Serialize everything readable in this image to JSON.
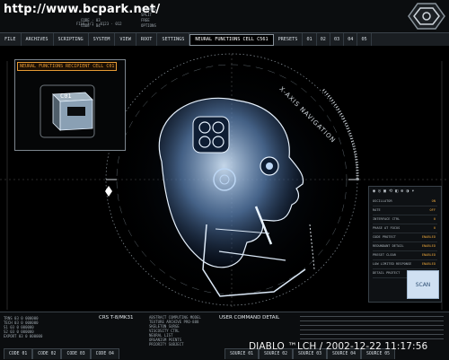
{
  "header": {
    "url": "http://www.bcpark.net/",
    "info_blocks": [
      [
        "FILE 1/1 · 0123 · 012"
      ],
      [
        "CODE · 03",
        "CODE · 04 ·"
      ],
      [
        "4 COMPS",
        "SPLIT",
        "FREE",
        "OPTIONS"
      ]
    ]
  },
  "menu": {
    "items": [
      "FILE",
      "ARCHIVES",
      "SCRIPTING",
      "SYSTEM",
      "VIEW",
      "ROOT",
      "SETTINGS"
    ],
    "active": "NEURAL FUNCTIONS CELL C561",
    "presets": "PRESETS",
    "preset_nums": [
      "01",
      "02",
      "03",
      "04",
      "05"
    ]
  },
  "inset": {
    "title": "NEURAL FUNCTIONS RECIPIENT CELL C01",
    "cube_label": "C01"
  },
  "overlay": {
    "x_axis_label": "X-AXIS NAVIGATION"
  },
  "panel": {
    "rows": [
      {
        "label": "OSCILLATOR",
        "value": "ON"
      },
      {
        "label": "RATE",
        "value": "OFF"
      },
      {
        "label": "INTERFACE CTRL",
        "value": "0"
      },
      {
        "label": "PHASE AT FOCUS",
        "value": "0"
      },
      {
        "label": "CODE PROTECT",
        "value": "ENABLED"
      },
      {
        "label": "REDUNDANT DETAIL",
        "value": "ENABLED"
      },
      {
        "label": "PRESET CLEAR",
        "value": "ENABLED"
      },
      {
        "label": "LOW LIMITED RESPONSE",
        "value": "ENABLED"
      },
      {
        "label": "DETAIL PROTECT",
        "value": "ENABLED"
      }
    ],
    "scan_label": "SCAN"
  },
  "bottom": {
    "left_stats": [
      "TRNS  03  0 000000",
      "TECH  03  0 000000",
      "S1    03  0 000000",
      "S2    03  0 000000",
      "EXPORT 03 0 000000"
    ],
    "crs_label": "CRS T-8/MK31",
    "center_text": [
      "ABSTRACT COMPUTING MODEL",
      "TEXTURE ARCHIVE PRO-888",
      "SKELETON SURGE",
      "VISCOSITY CTRL",
      "NEURAL LIST",
      "ORGANISM POINTS",
      "PRIORITY SUBJECT",
      "HIGH TRACER"
    ],
    "ucd_label": "USER COMMAND DETAIL",
    "code_tabs": [
      "CODE 01",
      "CODE 02",
      "CODE 03",
      "CODE 04"
    ],
    "source_tabs": [
      "SOURCE 01",
      "SOURCE 02",
      "SOURCE 03",
      "SOURCE 04",
      "SOURCE 05"
    ],
    "watermark": "DIABLO ™LCH / 2002-12-22 11:17:56"
  }
}
